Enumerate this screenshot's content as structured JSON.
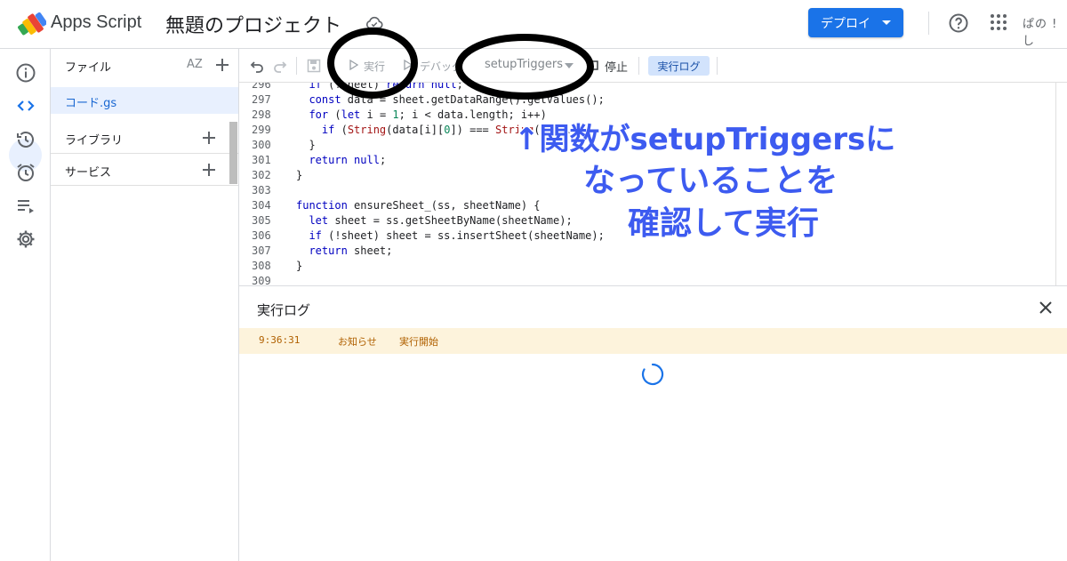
{
  "header": {
    "app_name": "Apps Script",
    "project_title": "無題のプロジェクト",
    "deploy_label": "デプロイ",
    "account_text": "ぱの ! し"
  },
  "files": {
    "title": "ファイル",
    "sort_label": "AZ",
    "items": [
      {
        "name": "コード.gs"
      }
    ],
    "sections": [
      {
        "label": "ライブラリ"
      },
      {
        "label": "サービス"
      }
    ]
  },
  "toolbar": {
    "run_label": "実行",
    "debug_label": "デバッグ",
    "function_name": "setupTriggers",
    "stop_label": "停止",
    "log_label": "実行ログ"
  },
  "code": {
    "lines": [
      {
        "num": "296",
        "text": "  if (!sheet) return null;"
      },
      {
        "num": "297",
        "text": "  const data = sheet.getDataRange().getValues();"
      },
      {
        "num": "298",
        "text": "  for (let i = 1; i < data.length; i++)"
      },
      {
        "num": "299",
        "text": "    if (String(data[i][0]) === String(cli..."
      },
      {
        "num": "300",
        "text": "  }"
      },
      {
        "num": "301",
        "text": "  return null;"
      },
      {
        "num": "302",
        "text": "}"
      },
      {
        "num": "303",
        "text": ""
      },
      {
        "num": "304",
        "text": "function ensureSheet_(ss, sheetName) {"
      },
      {
        "num": "305",
        "text": "  let sheet = ss.getSheetByName(sheetName);"
      },
      {
        "num": "306",
        "text": "  if (!sheet) sheet = ss.insertSheet(sheetName);"
      },
      {
        "num": "307",
        "text": "  return sheet;"
      },
      {
        "num": "308",
        "text": "}"
      },
      {
        "num": "309",
        "text": ""
      }
    ]
  },
  "log": {
    "title": "実行ログ",
    "entries": [
      {
        "time": "9:36:31",
        "level": "お知らせ",
        "message": "実行開始"
      }
    ]
  },
  "annotation": {
    "line1": "↑関数がsetupTriggersに",
    "line2": "なっていることを",
    "line3": "確認して実行",
    "color": "#3d5bf0"
  },
  "colors": {
    "accent": "#1a73e8",
    "active_bg": "#e8f0fe",
    "log_bg": "#fdf3dc"
  }
}
